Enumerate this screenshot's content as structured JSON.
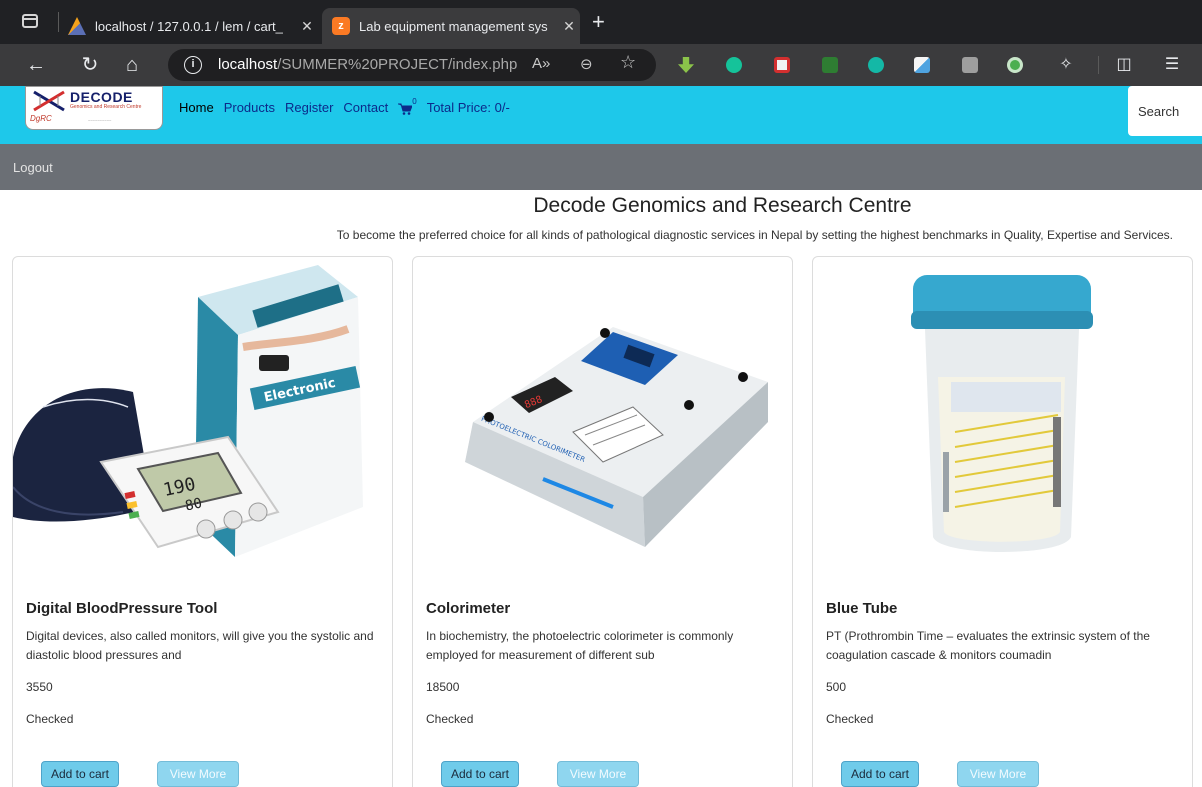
{
  "browser": {
    "tabs": [
      {
        "title": "localhost / 127.0.0.1 / lem / cart_",
        "favicon": "phpmyadmin-icon"
      },
      {
        "title": "Lab equipment management sys",
        "favicon": "xampp-icon"
      }
    ],
    "url_host": "localhost",
    "url_path": "/SUMMER%20PROJECT/index.php"
  },
  "site": {
    "logo_text": "DECODE",
    "logo_subtext": "Genomics and Research Centre",
    "logo_side": "DgRC",
    "nav": {
      "home": "Home",
      "products": "Products",
      "register": "Register",
      "contact": "Contact",
      "cart_count": "0",
      "total_price": "Total Price: 0/-"
    },
    "search_placeholder": "Search",
    "logout": "Logout",
    "accent_color": "#1ec8ea"
  },
  "hero": {
    "title": "Decode Genomics and Research Centre",
    "subtitle": "To become the preferred choice for all kinds of pathological diagnostic services in Nepal by setting the highest benchmarks in Quality, Expertise and Services."
  },
  "products": [
    {
      "name": "Digital BloodPressure Tool",
      "description": "Digital devices, also called monitors, will give you the systolic and diastolic blood pressures and",
      "price": "3550",
      "status": "Checked",
      "add_label": "Add to cart",
      "more_label": "View More"
    },
    {
      "name": "Colorimeter",
      "description": "In biochemistry, the photoelectric colorimeter is commonly employed for measurement of different sub",
      "price": "18500",
      "status": "Checked",
      "add_label": "Add to cart",
      "more_label": "View More"
    },
    {
      "name": "Blue Tube",
      "description": "PT (Prothrombin Time – evaluates the extrinsic system of the coagulation cascade & monitors coumadin",
      "price": "500",
      "status": "Checked",
      "add_label": "Add to cart",
      "more_label": "View More"
    }
  ]
}
